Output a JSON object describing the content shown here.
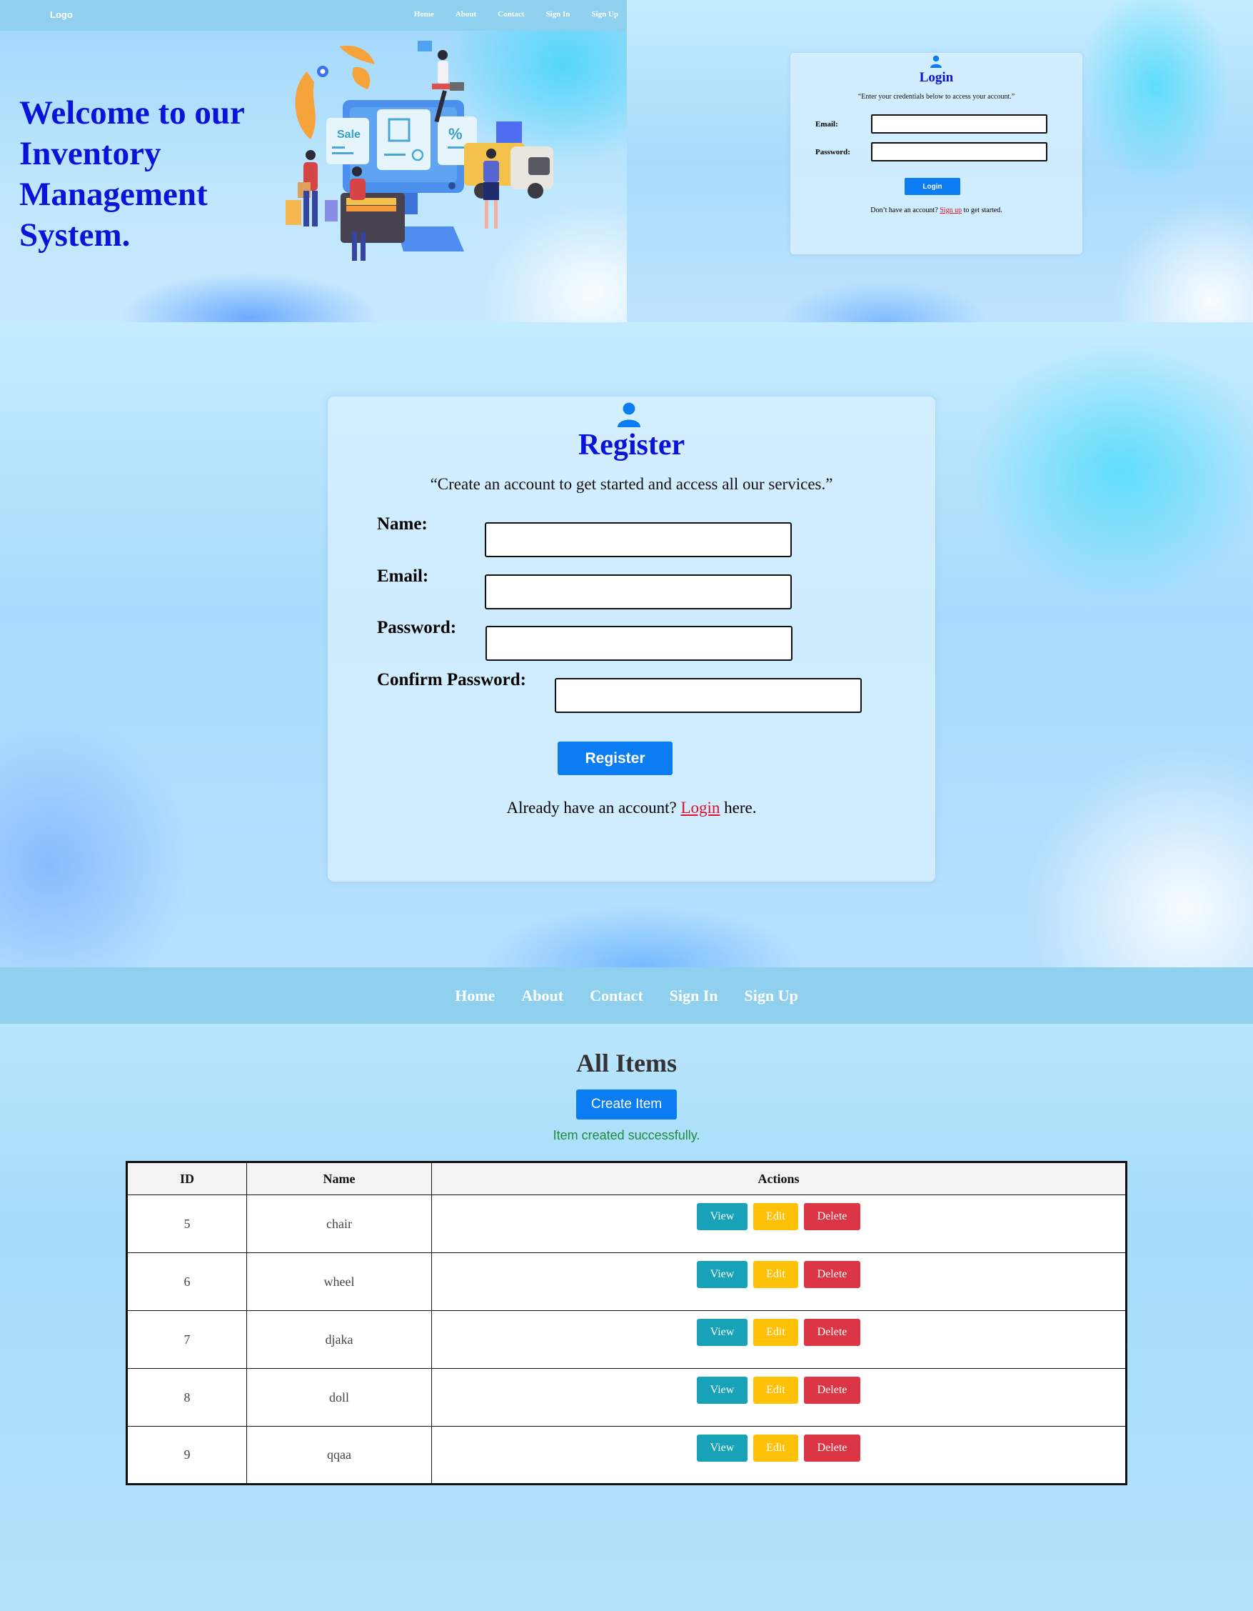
{
  "welcome_page": {
    "nav": {
      "logo": "Logo",
      "links": [
        "Home",
        "About",
        "Contact",
        "Sign In",
        "Sign Up"
      ]
    },
    "title": "Welcome to our Inventory Management System.",
    "illustration": {
      "sign_text": "Sale",
      "percent_text": "%"
    }
  },
  "login_page": {
    "icon": "user-icon",
    "title": "Login",
    "quote": "“Enter your credentials below to access your account.”",
    "fields": [
      {
        "label": "Email:",
        "value": ""
      },
      {
        "label": "Password:",
        "value": ""
      }
    ],
    "submit_label": "Login",
    "footer_prefix": "Don’t have an account? ",
    "footer_link": "Sign up",
    "footer_suffix": " to get started."
  },
  "register_page": {
    "icon": "user-icon",
    "title": "Register",
    "quote": "“Create an account to get started and access all our services.”",
    "fields": [
      {
        "label": "Name:",
        "value": ""
      },
      {
        "label": "Email:",
        "value": ""
      },
      {
        "label": "Password:",
        "value": ""
      },
      {
        "label": "Confirm Password:",
        "value": ""
      }
    ],
    "submit_label": "Register",
    "footer_prefix": "Already have an account? ",
    "footer_link": "Login",
    "footer_suffix": " here."
  },
  "items_page": {
    "nav": {
      "links": [
        "Home",
        "About",
        "Contact",
        "Sign In",
        "Sign Up"
      ]
    },
    "title": "All Items",
    "create_label": "Create Item",
    "success_message": "Item created successfully.",
    "table": {
      "headers": [
        "ID",
        "Name",
        "Actions"
      ],
      "rows": [
        {
          "id": "5",
          "name": "chair"
        },
        {
          "id": "6",
          "name": "wheel"
        },
        {
          "id": "7",
          "name": "djaka"
        },
        {
          "id": "8",
          "name": "doll"
        },
        {
          "id": "9",
          "name": "qqaa"
        }
      ],
      "action_labels": {
        "view": "View",
        "edit": "Edit",
        "delete": "Delete"
      }
    }
  },
  "colors": {
    "nav": "#8fd0ee",
    "title_blue": "#0a14d8",
    "primary": "#0b7cf2",
    "view": "#17a2b8",
    "edit": "#ffc107",
    "delete": "#dc3545",
    "success": "#1f8a3a",
    "link_red": "#e0102a"
  }
}
